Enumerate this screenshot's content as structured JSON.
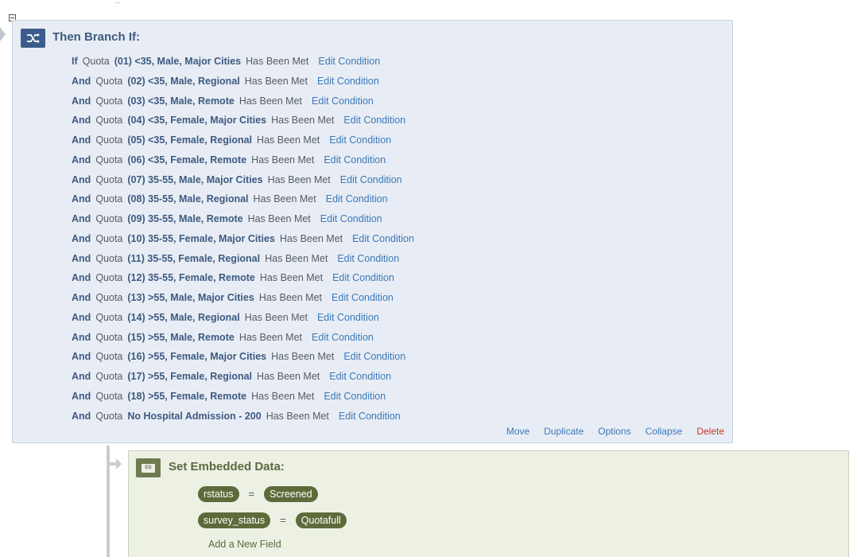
{
  "branch": {
    "title": "Then Branch If:",
    "icon": "branch-icon",
    "conditions": [
      {
        "conj": "If",
        "type": "Quota",
        "name": "(01) <35, Male, Major Cities",
        "status": "Has Been Met",
        "edit": "Edit Condition"
      },
      {
        "conj": "And",
        "type": "Quota",
        "name": "(02) <35, Male, Regional",
        "status": "Has Been Met",
        "edit": "Edit Condition"
      },
      {
        "conj": "And",
        "type": "Quota",
        "name": "(03) <35, Male, Remote",
        "status": "Has Been Met",
        "edit": "Edit Condition"
      },
      {
        "conj": "And",
        "type": "Quota",
        "name": "(04) <35, Female, Major Cities",
        "status": "Has Been Met",
        "edit": "Edit Condition"
      },
      {
        "conj": "And",
        "type": "Quota",
        "name": "(05) <35, Female, Regional",
        "status": "Has Been Met",
        "edit": "Edit Condition"
      },
      {
        "conj": "And",
        "type": "Quota",
        "name": "(06) <35, Female, Remote",
        "status": "Has Been Met",
        "edit": "Edit Condition"
      },
      {
        "conj": "And",
        "type": "Quota",
        "name": "(07) 35-55, Male, Major Cities",
        "status": "Has Been Met",
        "edit": "Edit Condition"
      },
      {
        "conj": "And",
        "type": "Quota",
        "name": "(08) 35-55, Male, Regional",
        "status": "Has Been Met",
        "edit": "Edit Condition"
      },
      {
        "conj": "And",
        "type": "Quota",
        "name": "(09) 35-55, Male, Remote",
        "status": "Has Been Met",
        "edit": "Edit Condition"
      },
      {
        "conj": "And",
        "type": "Quota",
        "name": "(10) 35-55, Female, Major Cities",
        "status": "Has Been Met",
        "edit": "Edit Condition"
      },
      {
        "conj": "And",
        "type": "Quota",
        "name": "(11) 35-55, Female, Regional",
        "status": "Has Been Met",
        "edit": "Edit Condition"
      },
      {
        "conj": "And",
        "type": "Quota",
        "name": "(12) 35-55, Female, Remote",
        "status": "Has Been Met",
        "edit": "Edit Condition"
      },
      {
        "conj": "And",
        "type": "Quota",
        "name": "(13) >55, Male, Major Cities",
        "status": "Has Been Met",
        "edit": "Edit Condition"
      },
      {
        "conj": "And",
        "type": "Quota",
        "name": "(14) >55, Male, Regional",
        "status": "Has Been Met",
        "edit": "Edit Condition"
      },
      {
        "conj": "And",
        "type": "Quota",
        "name": "(15) >55, Male, Remote",
        "status": "Has Been Met",
        "edit": "Edit Condition"
      },
      {
        "conj": "And",
        "type": "Quota",
        "name": "(16) >55, Female, Major Cities",
        "status": "Has Been Met",
        "edit": "Edit Condition"
      },
      {
        "conj": "And",
        "type": "Quota",
        "name": "(17) >55, Female, Regional",
        "status": "Has Been Met",
        "edit": "Edit Condition"
      },
      {
        "conj": "And",
        "type": "Quota",
        "name": "(18) >55, Female, Remote",
        "status": "Has Been Met",
        "edit": "Edit Condition"
      },
      {
        "conj": "And",
        "type": "Quota",
        "name": "No Hospital Admission - 200",
        "status": "Has Been Met",
        "edit": "Edit Condition"
      }
    ],
    "actions": {
      "move": "Move",
      "duplicate": "Duplicate",
      "options": "Options",
      "collapse": "Collapse",
      "delete": "Delete"
    }
  },
  "embedded": {
    "title": "Set Embedded Data:",
    "icon_text": "ED",
    "fields": [
      {
        "name": "rstatus",
        "eq": "=",
        "value": "Screened"
      },
      {
        "name": "survey_status",
        "eq": "=",
        "value": "Quotafull"
      }
    ],
    "add_field": "Add a New Field"
  },
  "colors": {
    "branch_bg": "#e8edf5",
    "branch_accent": "#3c5d8c",
    "link": "#3b78b8",
    "delete": "#c0392b",
    "embedded_bg": "#edf1e4",
    "pill": "#5d6b3a"
  }
}
